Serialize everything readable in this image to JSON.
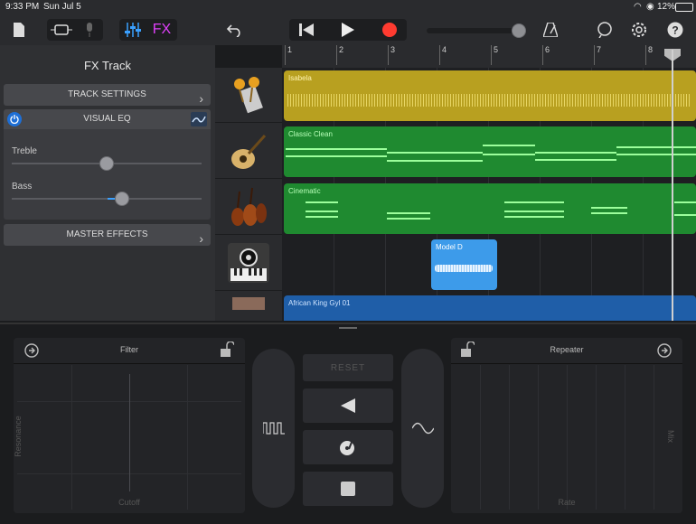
{
  "status_bar": {
    "time": "9:33 PM",
    "date": "Sun Jul 5",
    "battery": "12%"
  },
  "toolbar": {
    "fx_label": "FX",
    "icons": [
      "document-icon",
      "track-view-icon",
      "mic-icon",
      "mixer-icon",
      "undo-icon",
      "rewind-icon",
      "play-icon",
      "record-icon",
      "metronome-icon",
      "loop-icon",
      "settings-icon",
      "help-icon"
    ],
    "accent": "#ff3b30",
    "fx_color": "#e040fb"
  },
  "left_panel": {
    "title": "FX Track",
    "track_settings": "TRACK SETTINGS",
    "visual_eq": "VISUAL EQ",
    "treble_label": "Treble",
    "bass_label": "Bass",
    "master_effects": "MASTER EFFECTS",
    "treble_level": 0.5,
    "bass_level": 0.56
  },
  "ruler": {
    "bars": [
      "1",
      "2",
      "3",
      "4",
      "5",
      "6",
      "7",
      "8"
    ]
  },
  "tracks": [
    {
      "instrument": "percussion-icon",
      "region": "Isabela",
      "color": "#b8a020"
    },
    {
      "instrument": "guitar-icon",
      "region": "Classic Clean",
      "color": "#1f8a30"
    },
    {
      "instrument": "strings-icon",
      "region": "Cinematic",
      "color": "#1f8a30"
    },
    {
      "instrument": "synth-icon",
      "region": "Model D",
      "color": "#3d9bea"
    },
    {
      "instrument": "keyboard-icon",
      "region": "African King Gyl 01",
      "color": "#1f5ea8"
    }
  ],
  "fx": {
    "left_pad": {
      "title": "Filter",
      "x_label": "Cutoff",
      "y_label": "Resonance"
    },
    "right_pad": {
      "title": "Repeater",
      "x_label": "Rate",
      "y_label": "Mix"
    },
    "reset_label": "RESET"
  }
}
